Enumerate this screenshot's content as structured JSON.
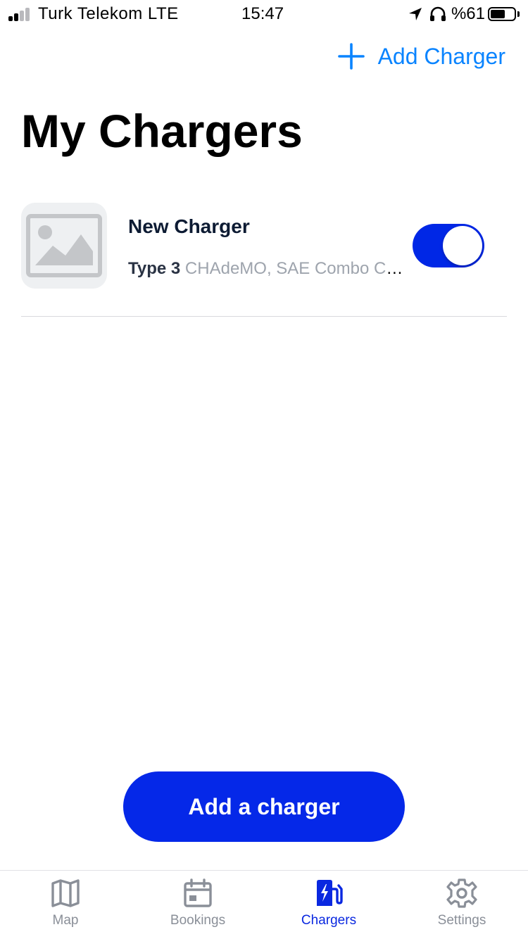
{
  "status_bar": {
    "carrier": "Turk Telekom  LTE",
    "time": "15:47",
    "battery_percent": "%61",
    "battery_level": 0.61
  },
  "header": {
    "add_charger_label": "Add Charger",
    "title": "My Chargers"
  },
  "chargers": [
    {
      "name": "New Charger",
      "type": "Type 3",
      "plugs": "CHAdeMO, SAE Combo CCS",
      "enabled": true
    }
  ],
  "primary_button_label": "Add a charger",
  "tab_bar": {
    "tabs": [
      {
        "label": "Map",
        "icon": "map-icon",
        "active": false
      },
      {
        "label": "Bookings",
        "icon": "calendar-icon",
        "active": false
      },
      {
        "label": "Chargers",
        "icon": "ev-charger-icon",
        "active": true
      },
      {
        "label": "Settings",
        "icon": "gear-icon",
        "active": false
      }
    ]
  },
  "colors": {
    "brand_blue": "#0528e8",
    "link_blue": "#0a84ff",
    "inactive_tab": "#8a8f98"
  }
}
